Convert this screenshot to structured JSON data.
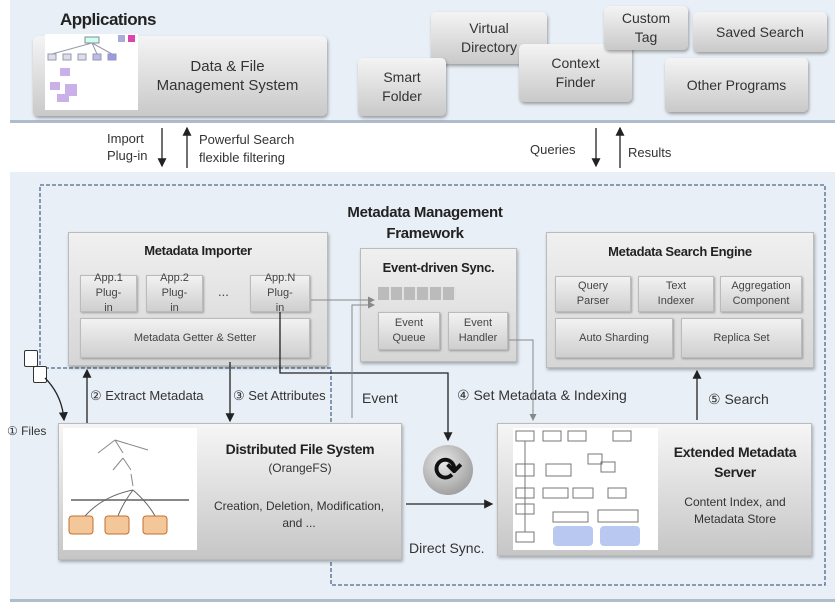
{
  "applications": {
    "title": "Applications",
    "main_app": "Data & File Management System",
    "items": [
      "Virtual Directory",
      "Smart Folder",
      "Context Finder",
      "Custom Tag",
      "Saved Search",
      "Other Programs"
    ]
  },
  "interface": {
    "import_label": "Import Plug-in",
    "search_label_1": "Powerful Search",
    "search_label_2": "flexible filtering",
    "queries": "Queries",
    "results": "Results"
  },
  "framework": {
    "title_1": "Metadata Management",
    "title_2": "Framework",
    "importer": {
      "title": "Metadata Importer",
      "plugins": [
        "App.1 Plug-in",
        "App.2 Plug-in",
        "App.N Plug-in"
      ],
      "ellipsis": "...",
      "getter_setter": "Metadata Getter & Setter"
    },
    "sync": {
      "title": "Event-driven Sync.",
      "queue": "Event Queue",
      "handler": "Event Handler"
    },
    "search_engine": {
      "title": "Metadata Search Engine",
      "components": [
        "Query Parser",
        "Text Indexer",
        "Aggregation Component",
        "Auto Sharding",
        "Replica Set"
      ]
    }
  },
  "flows": {
    "files": "① Files",
    "extract": "② Extract Metadata",
    "set_attributes": "③ Set Attributes",
    "event": "Event",
    "set_metadata": "④ Set Metadata  & Indexing",
    "search": "⑤ Search",
    "direct_sync": "Direct Sync."
  },
  "dfs": {
    "title": "Distributed File System",
    "subtitle": "(OrangeFS)",
    "ops": "Creation, Deletion, Modification, and ..."
  },
  "ems": {
    "title": "Extended Metadata Server",
    "desc": "Content Index, and Metadata Store"
  },
  "colors": {
    "band": "#e9eff6",
    "dashed": "#4a6a8a",
    "thumb_orange": "#f3c79a",
    "thumb_blue": "#b8c8f0"
  }
}
